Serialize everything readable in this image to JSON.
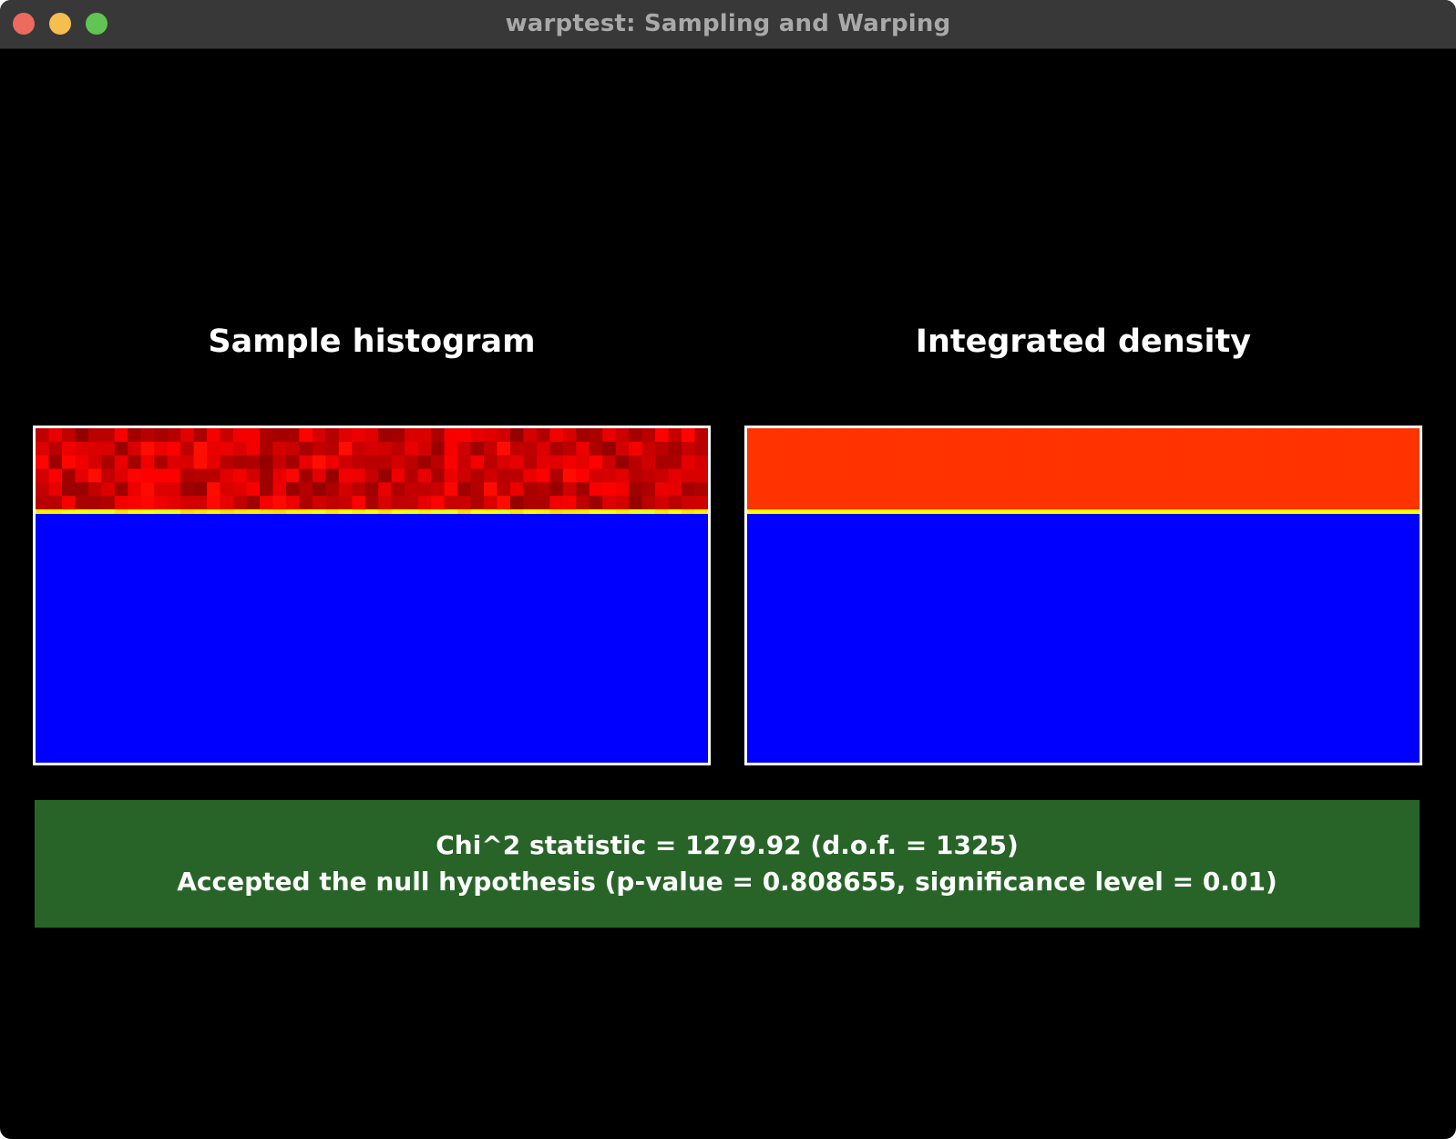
{
  "window": {
    "title": "warptest: Sampling and Warping"
  },
  "panels": {
    "left_title": "Sample histogram",
    "right_title": "Integrated density"
  },
  "status": {
    "line1": "Chi^2 statistic = 1279.92 (d.o.f. = 1325)",
    "line2": "Accepted the null hypothesis (p-value = 0.808655, significance level = 0.01)",
    "color": "#286428"
  },
  "colors": {
    "background": "#000000",
    "plot_low": "#0000ff",
    "plot_high": "#ff3300",
    "boundary": "#ffff00",
    "close": "#ec6a5e",
    "minimize": "#f4bf4f",
    "maximize": "#61c554"
  },
  "chart_data": [
    {
      "type": "heatmap",
      "title": "Sample histogram",
      "grid_cols": 51,
      "grid_rows": 26,
      "high_rows": 6,
      "boundary_row": 6,
      "noisy": true,
      "colormap": "jet"
    },
    {
      "type": "heatmap",
      "title": "Integrated density",
      "grid_cols": 51,
      "grid_rows": 26,
      "high_rows": 6,
      "boundary_row": 6,
      "noisy": false,
      "colormap": "jet"
    }
  ]
}
